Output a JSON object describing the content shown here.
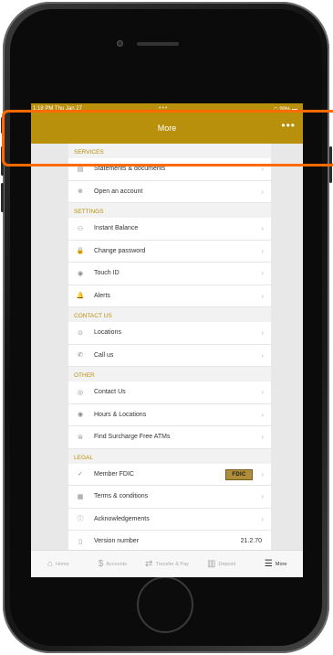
{
  "status_bar": {
    "time_date": "1:18 PM  Thu Jan 27",
    "dots": "•••",
    "battery": "99%"
  },
  "nav": {
    "title": "More",
    "more_glyph": "•••"
  },
  "sections": [
    {
      "header": "SERVICES",
      "rows": [
        {
          "label": "Statements & documents",
          "icon": "document-icon",
          "icon_glyph": "▤"
        },
        {
          "label": "Open an account",
          "icon": "plus-circle-icon",
          "icon_glyph": "⊕"
        }
      ]
    },
    {
      "header": "SETTINGS",
      "rows": [
        {
          "label": "Instant Balance",
          "icon": "hand-coin-icon",
          "icon_glyph": "⚇"
        },
        {
          "label": "Change password",
          "icon": "lock-icon",
          "icon_glyph": "🔒"
        },
        {
          "label": "Touch ID",
          "icon": "fingerprint-icon",
          "icon_glyph": "◉"
        },
        {
          "label": "Alerts",
          "icon": "bell-icon",
          "icon_glyph": "🔔"
        }
      ]
    },
    {
      "header": "CONTACT US",
      "rows": [
        {
          "label": "Locations",
          "icon": "location-pin-icon",
          "icon_glyph": "⊙"
        },
        {
          "label": "Call us",
          "icon": "phone-icon",
          "icon_glyph": "✆"
        }
      ]
    },
    {
      "header": "OTHER",
      "rows": [
        {
          "label": "Contact Us",
          "icon": "phone-circle-icon",
          "icon_glyph": "◎"
        },
        {
          "label": "Hours & Locations",
          "icon": "location-circle-icon",
          "icon_glyph": "◉"
        },
        {
          "label": "Find Surcharge Free ATMs",
          "icon": "atm-icon",
          "icon_glyph": "⊜"
        }
      ]
    },
    {
      "header": "LEGAL",
      "rows": [
        {
          "label": "Member FDIC",
          "icon": "check-circle-icon",
          "icon_glyph": "✓",
          "badge": "FDIC"
        },
        {
          "label": "Terms & conditions",
          "icon": "doc-edit-icon",
          "icon_glyph": "▦"
        },
        {
          "label": "Acknowledgements",
          "icon": "info-icon",
          "icon_glyph": "ⓘ"
        },
        {
          "label": "Version number",
          "icon": "phone-device-icon",
          "icon_glyph": "▯",
          "value": "21.2.70"
        }
      ]
    }
  ],
  "chevron": "›",
  "tabs": [
    {
      "label": "Home",
      "icon": "home-icon",
      "glyph": "⌂"
    },
    {
      "label": "Accounts",
      "icon": "dollar-icon",
      "glyph": "$"
    },
    {
      "label": "Transfer & Pay",
      "icon": "transfer-icon",
      "glyph": "⇄"
    },
    {
      "label": "Deposit",
      "icon": "deposit-icon",
      "glyph": "▥"
    },
    {
      "label": "More",
      "icon": "menu-icon",
      "glyph": "☰",
      "active": true
    }
  ],
  "colors": {
    "accent": "#b8900c",
    "highlight": "#ff6a00"
  }
}
